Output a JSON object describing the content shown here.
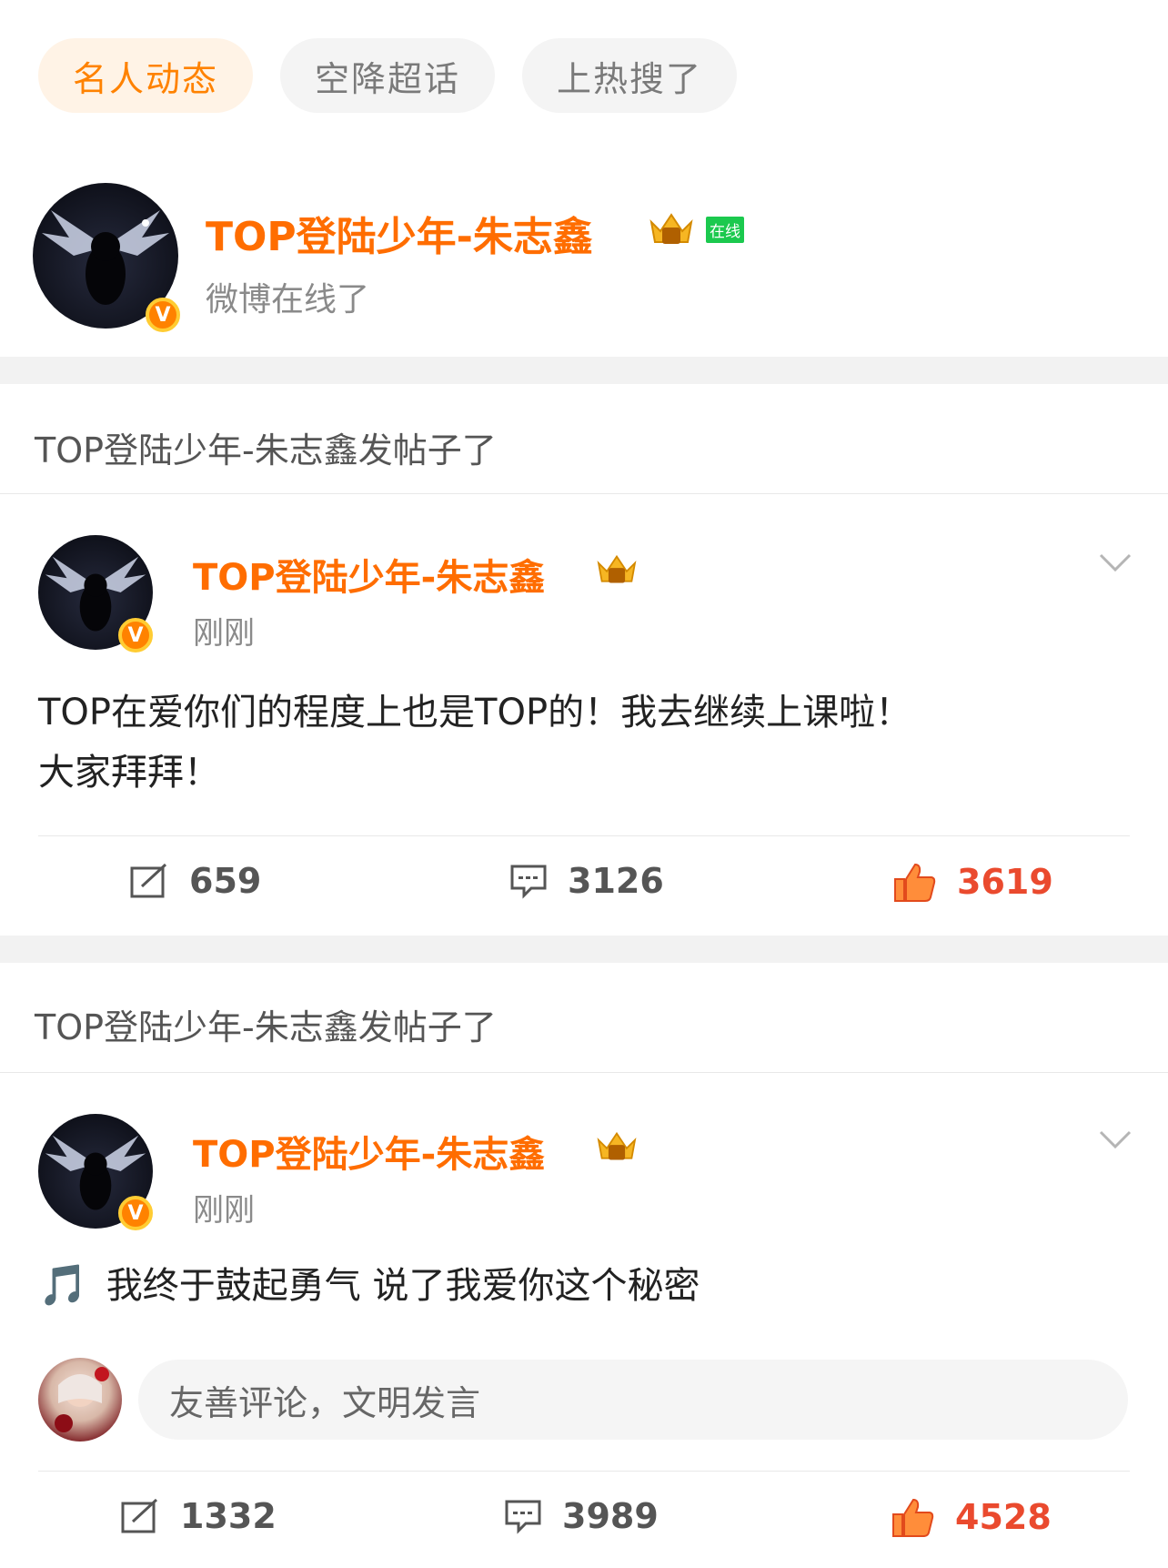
{
  "tabs": [
    {
      "label": "名人动态",
      "active": true
    },
    {
      "label": "空降超话",
      "active": false
    },
    {
      "label": "上热搜了",
      "active": false
    }
  ],
  "header_user": {
    "name": "TOP登陆少年-朱志鑫",
    "online_badge": "在线",
    "status": "微博在线了",
    "verified_mark": "V"
  },
  "posts": [
    {
      "section_title": "TOP登陆少年-朱志鑫发帖子了",
      "author": "TOP登陆少年-朱志鑫",
      "time": "刚刚",
      "text_line1": "TOP在爱你们的程度上也是TOP的！我去继续上课啦！",
      "text_line2": "大家拜拜！",
      "reposts": "659",
      "comments": "3126",
      "likes": "3619"
    },
    {
      "section_title": "TOP登陆少年-朱志鑫发帖子了",
      "author": "TOP登陆少年-朱志鑫",
      "time": "刚刚",
      "music_icon": "🎵",
      "text": "我终于鼓起勇气 说了我爱你这个秘密",
      "comment_placeholder": "友善评论，文明发言",
      "reposts": "1332",
      "comments": "3989",
      "likes": "4528"
    }
  ],
  "colors": {
    "accent": "#ff8200",
    "name": "#ff6d00",
    "like": "#ea4a2e",
    "online": "#1bc94e"
  }
}
